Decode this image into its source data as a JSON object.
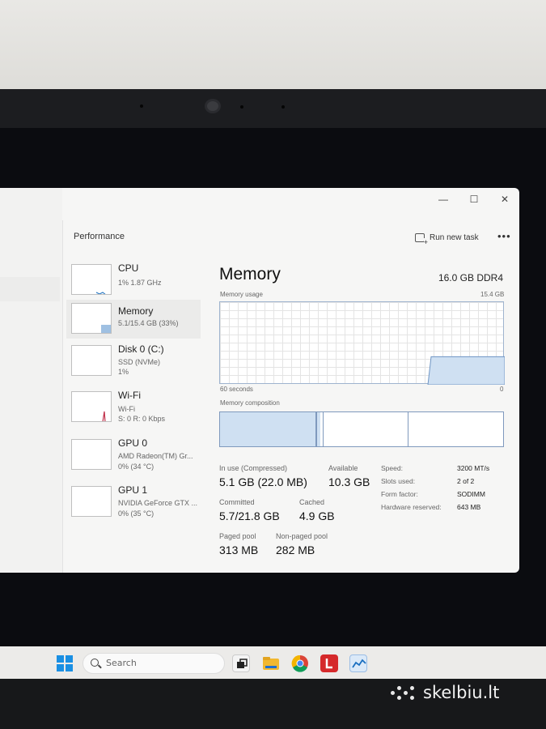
{
  "window": {
    "title": "Performance",
    "run_task_label": "Run new task",
    "more_label": "•••",
    "minimize_glyph": "—",
    "maximize_glyph": "☐",
    "close_glyph": "✕"
  },
  "sidebar": {
    "items": [
      {
        "name": "CPU",
        "line1": "1% 1.87 GHz",
        "line2": ""
      },
      {
        "name": "Memory",
        "line1": "5.1/15.4 GB (33%)",
        "line2": ""
      },
      {
        "name": "Disk 0 (C:)",
        "line1": "SSD (NVMe)",
        "line2": "1%"
      },
      {
        "name": "Wi-Fi",
        "line1": "Wi-Fi",
        "line2": "S: 0 R: 0 Kbps"
      },
      {
        "name": "GPU 0",
        "line1": "AMD Radeon(TM) Gr...",
        "line2": "0% (34 °C)"
      },
      {
        "name": "GPU 1",
        "line1": "NVIDIA GeForce GTX ...",
        "line2": "0% (35 °C)"
      }
    ]
  },
  "memory": {
    "title": "Memory",
    "total": "16.0 GB DDR4",
    "usage_label": "Memory usage",
    "usage_max": "15.4 GB",
    "time_label": "60 seconds",
    "time_zero": "0",
    "composition_label": "Memory composition",
    "composition": {
      "in_use_fraction": 0.34,
      "modified_fraction": 0.01,
      "standby_fraction": 0.3
    },
    "usage_level_fraction": 0.33,
    "stats": {
      "in_use_label": "In use (Compressed)",
      "in_use_value": "5.1 GB (22.0 MB)",
      "available_label": "Available",
      "available_value": "10.3 GB",
      "committed_label": "Committed",
      "committed_value": "5.7/21.8 GB",
      "cached_label": "Cached",
      "cached_value": "4.9 GB",
      "paged_label": "Paged pool",
      "paged_value": "313 MB",
      "nonpaged_label": "Non-paged pool",
      "nonpaged_value": "282 MB"
    },
    "specs": [
      {
        "k": "Speed:",
        "v": "3200 MT/s"
      },
      {
        "k": "Slots used:",
        "v": "2 of 2"
      },
      {
        "k": "Form factor:",
        "v": "SODIMM"
      },
      {
        "k": "Hardware reserved:",
        "v": "643 MB"
      }
    ]
  },
  "taskbar": {
    "search_placeholder": "Search"
  },
  "watermark": {
    "text": "skelbiu.lt"
  },
  "colors": {
    "accent": "#1a8fe3",
    "memory_fill": "#cfe0f2",
    "memory_line": "#7f99bd"
  }
}
